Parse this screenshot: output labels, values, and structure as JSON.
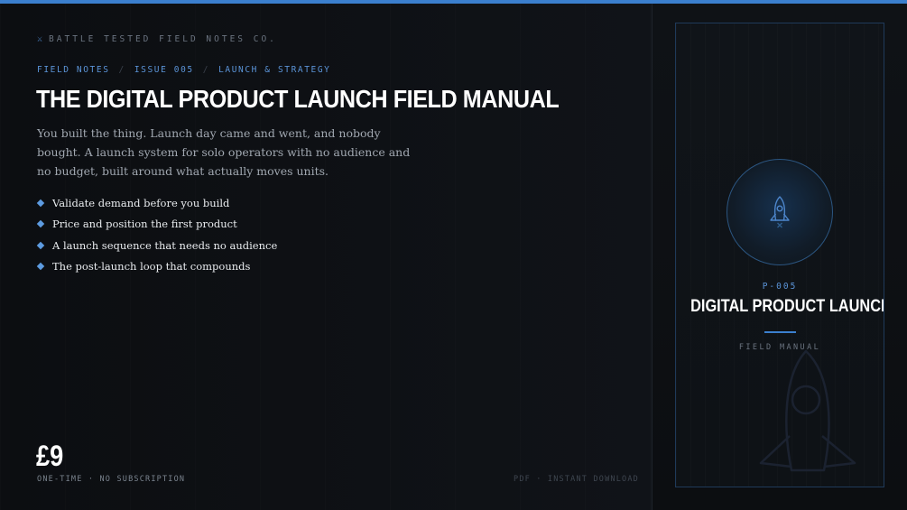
{
  "brand": {
    "icon": "crossed-swords-icon",
    "icon_glyph": "⚔",
    "name": "BATTLE TESTED FIELD NOTES CO."
  },
  "breadcrumb": {
    "items": [
      "FIELD NOTES",
      "ISSUE 005",
      "LAUNCH & STRATEGY"
    ],
    "separator": "/"
  },
  "product": {
    "title": "THE DIGITAL PRODUCT LAUNCH FIELD MANUAL",
    "description": "You built the thing. Launch day came and went, and nobody bought. A launch system for solo operators with no audience and no budget, built around what actually moves units.",
    "bullets": [
      "Validate demand before you build",
      "Price and position the first product",
      "A launch sequence that needs no audience",
      "The post-launch loop that compounds"
    ],
    "price": "£9",
    "price_note": "ONE-TIME · NO SUBSCRIPTION",
    "format_note": "PDF · INSTANT DOWNLOAD"
  },
  "cover": {
    "code": "P-005",
    "title": "DIGITAL PRODUCT LAUNCH",
    "subtitle": "FIELD MANUAL",
    "icon": "rocket-icon"
  },
  "colors": {
    "accent": "#3b7fce",
    "accent_light": "#5b94d8",
    "background": "#0d0f12",
    "text_primary": "#ffffff",
    "text_muted": "#a1a8b1"
  }
}
